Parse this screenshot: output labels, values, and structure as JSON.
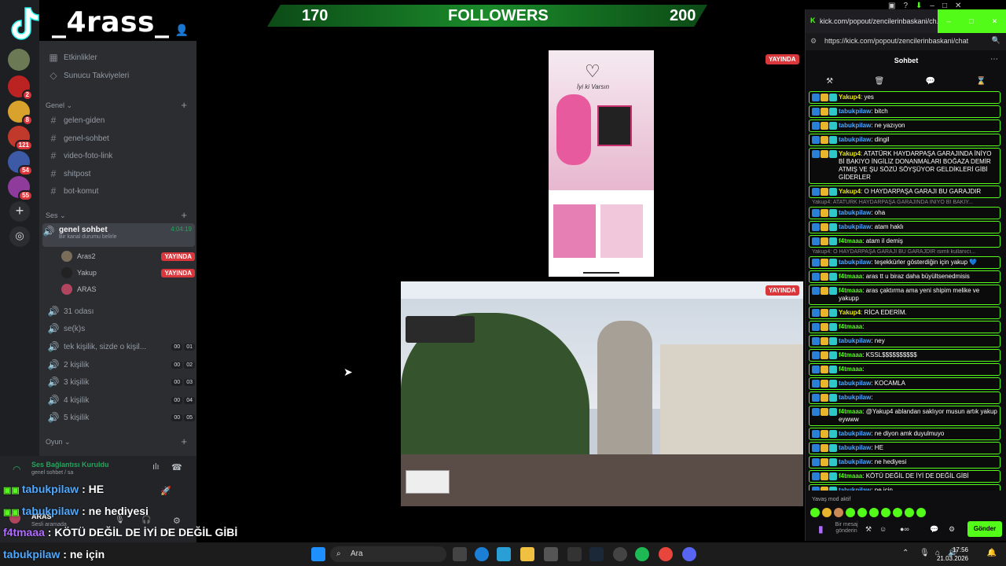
{
  "discord": {
    "server_name": "_4rass_",
    "rail_badges": [
      "2",
      "8",
      "121",
      "54",
      "55"
    ],
    "top_items": [
      "Etkinlikler",
      "Sunucu Takviyeleri"
    ],
    "category_general": "Genel",
    "text_channels": [
      "gelen-giden",
      "genel-sohbet",
      "video-foto-link",
      "shitpost",
      "bot-komut"
    ],
    "category_voice": "Ses",
    "active_voice": {
      "name": "genel sohbet",
      "timer": "4:04:19",
      "status": "Bir kanal durumu belirle"
    },
    "voice_users": [
      {
        "name": "Aras2",
        "live": "YAYINDA"
      },
      {
        "name": "Yakup",
        "live": "YAYINDA"
      },
      {
        "name": "ARAS",
        "live": ""
      }
    ],
    "voice_channels": [
      {
        "name": "31 odası",
        "a": "",
        "b": ""
      },
      {
        "name": "se(k)s",
        "a": "",
        "b": ""
      },
      {
        "name": "tek kişilik, sizde o kişil...",
        "a": "00",
        "b": "01"
      },
      {
        "name": "2 kişilik",
        "a": "00",
        "b": "02"
      },
      {
        "name": "3 kişilik",
        "a": "00",
        "b": "03"
      },
      {
        "name": "4 kişilik",
        "a": "00",
        "b": "04"
      },
      {
        "name": "5 kişilik",
        "a": "00",
        "b": "05"
      }
    ],
    "category_game": "Oyun",
    "connection": {
      "title": "Ses Bağlantısı Kuruldu",
      "subtitle": "genel sohbet / sa"
    },
    "me": {
      "name": "ARAS",
      "status": "Sesli aramada"
    }
  },
  "stream": {
    "followers_current": "170",
    "followers_label": "FOLLOWERS",
    "followers_goal": "200",
    "live_label": "YAYINDA",
    "phone_text": "İyi ki Varsın"
  },
  "overlay_chat": [
    {
      "user": "tabukpilaw",
      "text": "HE"
    },
    {
      "user": "tabukpilaw",
      "text": "ne hediyesi"
    },
    {
      "user": "f4tmaaa",
      "text": "KÖTÜ DEĞİL DE İYİ DE DEĞİL GİBİ"
    },
    {
      "user": "tabukpilaw",
      "text": "ne için"
    }
  ],
  "browser": {
    "title": "kick.com/popout/zencilerinbaskani/ch...",
    "url": "https://kick.com/popout/zencilerinbaskani/chat",
    "chat_title": "Sohbet",
    "slow_mode": "Yavaş mod aktif",
    "input_placeholder": "Bir mesaj gönderin",
    "send": "Gönder",
    "messages": [
      {
        "reply": "",
        "user": "Yakup4",
        "text": "yes"
      },
      {
        "reply": "",
        "user": "tabukpilaw",
        "text": "bitch"
      },
      {
        "reply": "",
        "user": "tabukpilaw",
        "text": "ne yazıyon"
      },
      {
        "reply": "",
        "user": "tabukpilaw",
        "text": "dingil"
      },
      {
        "reply": "",
        "user": "Yakup4",
        "text": "ATATÜRK HAYDARPAŞA GARAJINDA İNİYO Bİ BAKIYO İNGİLİZ DONANMALARI BOĞAZA DEMİR ATMIŞ VE ŞU SÖZÜ SÖYŞÜYOR GELDİKLERİ GİBİ GİDERLER"
      },
      {
        "reply": "",
        "user": "Yakup4",
        "text": "O HAYDARPAŞA GARAJI BU GARAJDIR"
      },
      {
        "reply": "Yakup4: ATATÜRK HAYDARPAŞA GARAJINDA İNİYO Bİ BAKIY...",
        "user": "tabukpilaw",
        "text": "oha"
      },
      {
        "reply": "",
        "user": "tabukpilaw",
        "text": "atam haklı"
      },
      {
        "reply": "",
        "user": "f4tmaaa",
        "text": "atam il demiş"
      },
      {
        "reply": "Yakup4: O HAYDARPAŞA GARAJI BU GARAJDIR isimli kullanıcı...",
        "user": "tabukpilaw",
        "text": "teşekkürler gösterdiğin için yakup 💙"
      },
      {
        "reply": "",
        "user": "f4tmaaa",
        "text": "aras tt u biraz daha büyültsenedmisis"
      },
      {
        "reply": "",
        "user": "f4tmaaa",
        "text": "aras çaktırma ama yeni shipim melike ve yakupp"
      },
      {
        "reply": "",
        "user": "Yakup4",
        "text": "RİCA EDERİM."
      },
      {
        "reply": "",
        "user": "f4tmaaa",
        "text": ""
      },
      {
        "reply": "",
        "user": "tabukpilaw",
        "text": "ney"
      },
      {
        "reply": "",
        "user": "f4tmaaa",
        "text": "KSSL$$$$$$$$$$"
      },
      {
        "reply": "",
        "user": "f4tmaaa",
        "text": ""
      },
      {
        "reply": "",
        "user": "tabukpilaw",
        "text": "KOCAMLA"
      },
      {
        "reply": "",
        "user": "tabukpilaw",
        "text": ""
      },
      {
        "reply": "",
        "user": "f4tmaaa",
        "text": "@Yakup4 ablandan saklıyor musun artık yakup eywww"
      },
      {
        "reply": "",
        "user": "tabukpilaw",
        "text": "ne diyon amk duyulmuyo"
      },
      {
        "reply": "",
        "user": "tabukpilaw",
        "text": "HE"
      },
      {
        "reply": "",
        "user": "tabukpilaw",
        "text": "ne hediyesi"
      },
      {
        "reply": "",
        "user": "f4tmaaa",
        "text": "KÖTÜ DEĞİL DE İYİ DE DEĞİL GİBİ"
      },
      {
        "reply": "",
        "user": "tabukpilaw",
        "text": "ne için"
      }
    ]
  },
  "taskbar": {
    "search": "Ara",
    "time": "17:56",
    "date": "21.03.2026"
  },
  "colors": {
    "kick_green": "#53fc18",
    "discord_red": "#da373c",
    "user_blue": "#4ea8ff"
  }
}
